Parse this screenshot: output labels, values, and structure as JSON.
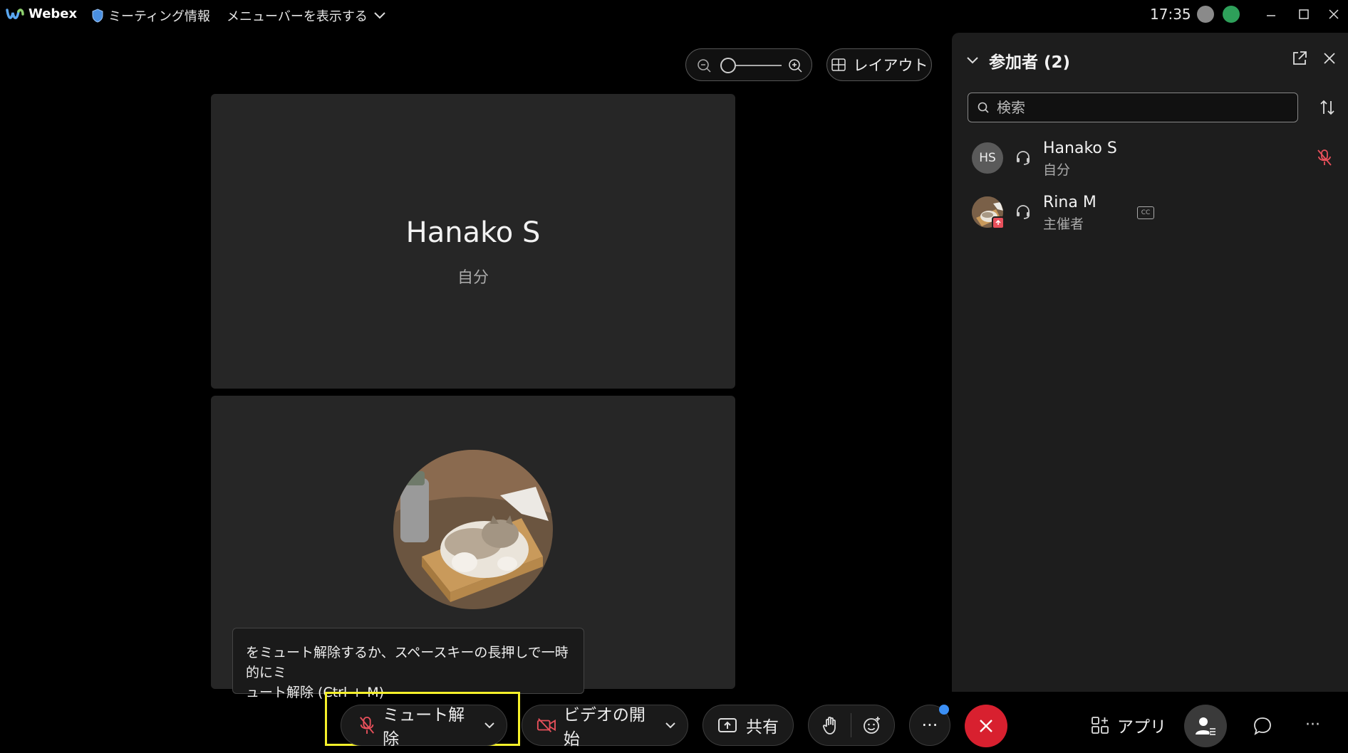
{
  "titlebar": {
    "app_name": "Webex",
    "meeting_info": "ミーティング情報",
    "show_menu": "メニューバーを表示する",
    "time": "17:35"
  },
  "top_controls": {
    "layout_label": "レイアウト"
  },
  "tiles": [
    {
      "name": "Hanako S",
      "subtitle": "自分"
    },
    {
      "name": "",
      "subtitle": ""
    }
  ],
  "tooltip": {
    "line1": "をミュート解除するか、スペースキーの長押しで一時的にミ",
    "line2": "ュート解除 (Ctrl + M)"
  },
  "bottom_bar": {
    "unmute_label": "ミュート解除",
    "video_label": "ビデオの開始",
    "share_label": "共有",
    "more_label": "···",
    "apps_label": "アプリ",
    "overflow_label": "···"
  },
  "panel": {
    "title": "参加者 (2)",
    "search_placeholder": "検索",
    "participants": [
      {
        "initials": "HS",
        "name": "Hanako S",
        "role": "自分",
        "muted": true
      },
      {
        "initials": "",
        "name": "Rina M",
        "role": "主催者",
        "cc": "CC"
      }
    ]
  },
  "colors": {
    "end_call": "#d8202f",
    "highlight": "#f5f02a",
    "mute_icon": "#e8505b",
    "notification": "#3b8ff5"
  }
}
